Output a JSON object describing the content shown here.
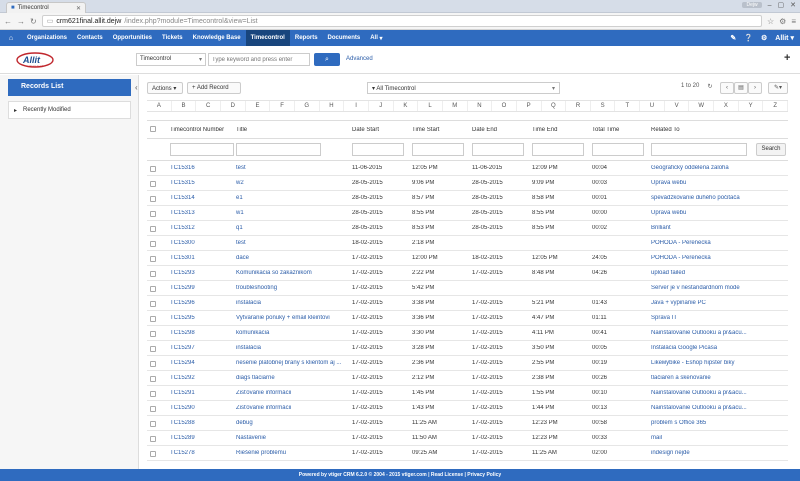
{
  "browser": {
    "tab_title": "Timecontrol",
    "url_host": "crm621final.allit.dejw",
    "url_path": "/index.php?module=Timecontrol&view=List",
    "user_badge": "Dejw"
  },
  "nav": {
    "items": [
      "Organizations",
      "Contacts",
      "Opportunities",
      "Tickets",
      "Knowledge Base",
      "Timecontrol",
      "Reports",
      "Documents",
      "All"
    ],
    "user": "Allit"
  },
  "header": {
    "logo_text": "Allit",
    "logo_tagline": "all you need",
    "module_select": "Timecontrol",
    "search_placeholder": "Type keyword and press enter",
    "advanced": "Advanced"
  },
  "sidebar": {
    "title": "Records List",
    "items": [
      "Recently Modified"
    ]
  },
  "toolbar": {
    "actions": "Actions",
    "add_record": "Add Record",
    "filter": "All Timecontrol",
    "pager": "1 to 20"
  },
  "alphabet": [
    "A",
    "B",
    "C",
    "D",
    "E",
    "F",
    "G",
    "H",
    "I",
    "J",
    "K",
    "L",
    "M",
    "N",
    "O",
    "P",
    "Q",
    "R",
    "S",
    "T",
    "U",
    "V",
    "W",
    "X",
    "Y",
    "Z"
  ],
  "table": {
    "columns": [
      "Timecontrol Number",
      "Title",
      "Date Start",
      "Time Start",
      "Date End",
      "Time End",
      "Total Time",
      "Related To"
    ],
    "search_button": "Search",
    "rows": [
      {
        "num": "TC15316",
        "title": "test",
        "ds": "11-06-2015",
        "ts": "12:05 PM",
        "de": "11-06-2015",
        "te": "12:09 PM",
        "tt": "00:04",
        "rel": "Geografický oddelena zaloha"
      },
      {
        "num": "TC15315",
        "title": "w2",
        "ds": "28-05-2015",
        "ts": "9:06 PM",
        "de": "28-05-2015",
        "te": "9:09 PM",
        "tt": "00:03",
        "rel": "Uprava webu"
      },
      {
        "num": "TC15314",
        "title": "e1",
        "ds": "28-05-2015",
        "ts": "8:57 PM",
        "de": "28-05-2015",
        "te": "8:58 PM",
        "tt": "00:01",
        "rel": "spevádzkovanie duhého počitača"
      },
      {
        "num": "TC15313",
        "title": "w1",
        "ds": "28-05-2015",
        "ts": "8:55 PM",
        "de": "28-05-2015",
        "te": "8:55 PM",
        "tt": "00:00",
        "rel": "Uprava webu"
      },
      {
        "num": "TC15312",
        "title": "q1",
        "ds": "28-05-2015",
        "ts": "8:53 PM",
        "de": "28-05-2015",
        "te": "8:55 PM",
        "tt": "00:02",
        "rel": "Brilliant"
      },
      {
        "num": "TC15300",
        "title": "test",
        "ds": "18-02-2015",
        "ts": "2:18 PM",
        "de": "",
        "te": "",
        "tt": "",
        "rel": "POHODA - Perenecká"
      },
      {
        "num": "TC15301",
        "title": "dace",
        "ds": "17-02-2015",
        "ts": "12:00 PM",
        "de": "18-02-2015",
        "te": "12:05 PM",
        "tt": "24:05",
        "rel": "POHODA - Perenecká"
      },
      {
        "num": "TC15293",
        "title": "Komunikacia so zakaznikom",
        "ds": "17-02-2015",
        "ts": "2:22 PM",
        "de": "17-02-2015",
        "te": "8:48 PM",
        "tt": "04:26",
        "rel": "upload failed"
      },
      {
        "num": "TC15299",
        "title": "troubleshooting",
        "ds": "17-02-2015",
        "ts": "5:42 PM",
        "de": "",
        "te": "",
        "tt": "",
        "rel": "Server je v nestandardnom mode"
      },
      {
        "num": "TC15296",
        "title": "instalacia",
        "ds": "17-02-2015",
        "ts": "3:38 PM",
        "de": "17-02-2015",
        "te": "5:21 PM",
        "tt": "01:43",
        "rel": "Java + vypinanie PC"
      },
      {
        "num": "TC15295",
        "title": "Vytvaranie ponuky + email kleintovi",
        "ds": "17-02-2015",
        "ts": "3:36 PM",
        "de": "17-02-2015",
        "te": "4:47 PM",
        "tt": "01:11",
        "rel": "Sprava IT"
      },
      {
        "num": "TC15298",
        "title": "komunikacia",
        "ds": "17-02-2015",
        "ts": "3:30 PM",
        "de": "17-02-2015",
        "te": "4:11 PM",
        "tt": "00:41",
        "rel": "Nainštalovanie Outlooku a pr&acu..."
      },
      {
        "num": "TC15297",
        "title": "inštalácia",
        "ds": "17-02-2015",
        "ts": "3:28 PM",
        "de": "17-02-2015",
        "te": "3:50 PM",
        "tt": "00:05",
        "rel": "Inštalácia Google Picasa"
      },
      {
        "num": "TC15294",
        "title": "riesenie platobnej brany s klientom aj ...",
        "ds": "17-02-2015",
        "ts": "2:36 PM",
        "de": "17-02-2015",
        "te": "2:55 PM",
        "tt": "00:19",
        "rel": "Likeмybike - Eshop hipster biky"
      },
      {
        "num": "TC15292",
        "title": "diags tlaciarne",
        "ds": "17-02-2015",
        "ts": "2:12 PM",
        "de": "17-02-2015",
        "te": "2:38 PM",
        "tt": "00:26",
        "rel": "tlačiaren a skenovanie"
      },
      {
        "num": "TC15291",
        "title": "Zisťovanie informácii",
        "ds": "17-02-2015",
        "ts": "1:45 PM",
        "de": "17-02-2015",
        "te": "1:55 PM",
        "tt": "00:10",
        "rel": "Nainštalovanie Outlooku a pr&acu..."
      },
      {
        "num": "TC15290",
        "title": "Zisťovanie informácii",
        "ds": "17-02-2015",
        "ts": "1:43 PM",
        "de": "17-02-2015",
        "te": "1:44 PM",
        "tt": "00:13",
        "rel": "Nainštalovanie Outlooku a pr&acu..."
      },
      {
        "num": "TC15288",
        "title": "debug",
        "ds": "17-02-2015",
        "ts": "11:25 AM",
        "de": "17-02-2015",
        "te": "12:23 PM",
        "tt": "00:58",
        "rel": "problem s Office 365"
      },
      {
        "num": "TC15289",
        "title": "Nastavenie",
        "ds": "17-02-2015",
        "ts": "11:50 AM",
        "de": "17-02-2015",
        "te": "12:23 PM",
        "tt": "00:33",
        "rel": "mail"
      },
      {
        "num": "TC15278",
        "title": "Riešenie problému",
        "ds": "17-02-2015",
        "ts": "09:25 AM",
        "de": "17-02-2015",
        "te": "11:25 AM",
        "tt": "02:00",
        "rel": "indesign nejde"
      }
    ]
  },
  "footer": "Powered by vtiger CRM 6.2.0 © 2004 - 2015  vtiger.com | Read License | Privacy Policy"
}
